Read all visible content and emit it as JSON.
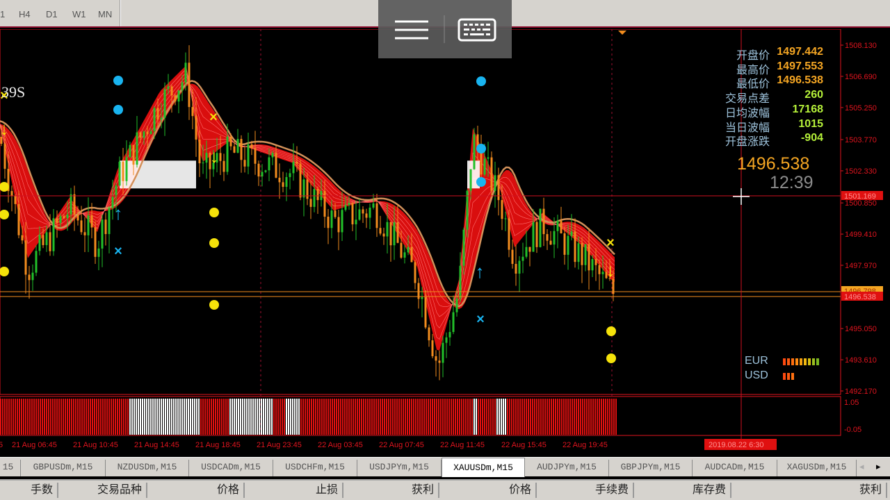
{
  "toolbar": {
    "timeframes": [
      "1",
      "H4",
      "D1",
      "W1",
      "MN"
    ]
  },
  "overlay": {
    "icons": [
      "menu-icon",
      "keyboard-icon"
    ]
  },
  "chart": {
    "indicator_label": "39S",
    "info_panel": [
      {
        "label": "开盘价",
        "value": "1497.442",
        "color": "#f5a623"
      },
      {
        "label": "最高价",
        "value": "1497.553",
        "color": "#f5a623"
      },
      {
        "label": "最低价",
        "value": "1496.538",
        "color": "#f5a623"
      },
      {
        "label": "交易点差",
        "value": "260",
        "color": "#b6f23a"
      },
      {
        "label": "日均波幅",
        "value": "17168",
        "color": "#b6f23a"
      },
      {
        "label": "当日波幅",
        "value": "1015",
        "color": "#b6f23a"
      },
      {
        "label": "开盘涨跌",
        "value": "-904",
        "color": "#b6f23a"
      }
    ],
    "big_price": "1496.538",
    "countdown": "12:39",
    "strength": [
      {
        "currency": "EUR",
        "bars": 9
      },
      {
        "currency": "USD",
        "bars": 3
      }
    ],
    "price_axis": [
      "1508.130",
      "1506.690",
      "1505.250",
      "1503.770",
      "1502.330",
      "1500.850",
      "1499.410",
      "1497.970",
      "1495.050",
      "1493.610",
      "1492.170"
    ],
    "crosshair_price": "1501.169",
    "ask_price": "1496.798",
    "bid_price": "1496.538",
    "sub_axis": [
      "1.05",
      "-0.05"
    ],
    "time_axis": [
      "5",
      "21 Aug 06:45",
      "21 Aug 10:45",
      "21 Aug 14:45",
      "21 Aug 18:45",
      "21 Aug 23:45",
      "22 Aug 03:45",
      "22 Aug 07:45",
      "22 Aug 11:45",
      "22 Aug 15:45",
      "22 Aug 19:45"
    ],
    "crosshair_time": "2019.08.22 6:30",
    "colors": {
      "bull": "#22c02a",
      "bear": "#f28c1e",
      "ribbon": "#ff1010",
      "ma": "#d2915a",
      "axis": "#e0141e"
    }
  },
  "tabs": [
    "15",
    "GBPUSDm,M15",
    "NZDUSDm,M15",
    "USDCADm,M15",
    "USDCHFm,M15",
    "USDJPYm,M15",
    "XAUUSDm,M15",
    "AUDJPYm,M15",
    "GBPJPYm,M15",
    "AUDCADm,M15",
    "XAGUSDm,M15"
  ],
  "active_tab": "XAUUSDm,M15",
  "columns": [
    "手数",
    "交易品种",
    "价格",
    "止损",
    "获利",
    "价格",
    "手续费",
    "库存费",
    "获利"
  ]
}
